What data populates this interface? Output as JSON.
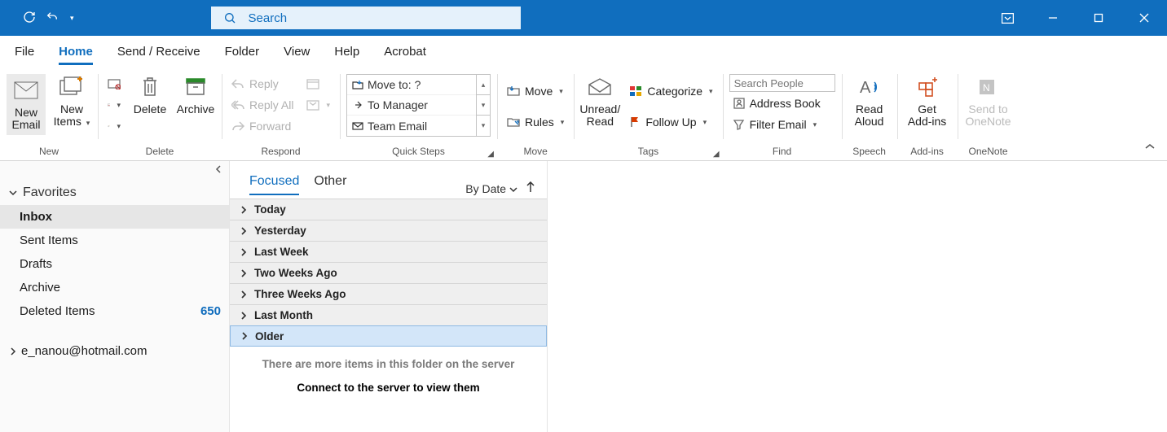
{
  "titlebar": {
    "search_placeholder": "Search"
  },
  "tabs": {
    "file": "File",
    "home": "Home",
    "send_receive": "Send / Receive",
    "folder": "Folder",
    "view": "View",
    "help": "Help",
    "acrobat": "Acrobat"
  },
  "ribbon": {
    "new": {
      "label": "New",
      "new_email_1": "New",
      "new_email_2": "Email",
      "new_items_1": "New",
      "new_items_2": "Items"
    },
    "delete": {
      "label": "Delete",
      "delete_btn": "Delete",
      "archive_btn": "Archive"
    },
    "respond": {
      "label": "Respond",
      "reply": "Reply",
      "reply_all": "Reply All",
      "forward": "Forward"
    },
    "quick_steps": {
      "label": "Quick Steps",
      "move_to": "Move to: ?",
      "to_manager": "To Manager",
      "team_email": "Team Email"
    },
    "move": {
      "label": "Move",
      "move_btn": "Move",
      "rules_btn": "Rules"
    },
    "tags": {
      "label": "Tags",
      "unread_1": "Unread/",
      "unread_2": "Read",
      "categorize": "Categorize",
      "follow_up": "Follow Up"
    },
    "find": {
      "label": "Find",
      "search_people_placeholder": "Search People",
      "address_book": "Address Book",
      "filter_email": "Filter Email"
    },
    "speech": {
      "label": "Speech",
      "read_1": "Read",
      "read_2": "Aloud"
    },
    "addins": {
      "label": "Add-ins",
      "get_1": "Get",
      "get_2": "Add-ins"
    },
    "onenote": {
      "label": "OneNote",
      "send_1": "Send to",
      "send_2": "OneNote"
    }
  },
  "nav": {
    "favorites": "Favorites",
    "items": [
      {
        "label": "Inbox"
      },
      {
        "label": "Sent Items"
      },
      {
        "label": "Drafts"
      },
      {
        "label": "Archive"
      },
      {
        "label": "Deleted Items",
        "count": "650"
      }
    ],
    "account": "e_nanou@hotmail.com"
  },
  "messages": {
    "tab_focused": "Focused",
    "tab_other": "Other",
    "sort_label": "By Date",
    "groups": [
      "Today",
      "Yesterday",
      "Last Week",
      "Two Weeks Ago",
      "Three Weeks Ago",
      "Last Month",
      "Older"
    ],
    "more_msg": "There are more items in this folder on the server",
    "connect_msg": "Connect to the server to view them"
  }
}
